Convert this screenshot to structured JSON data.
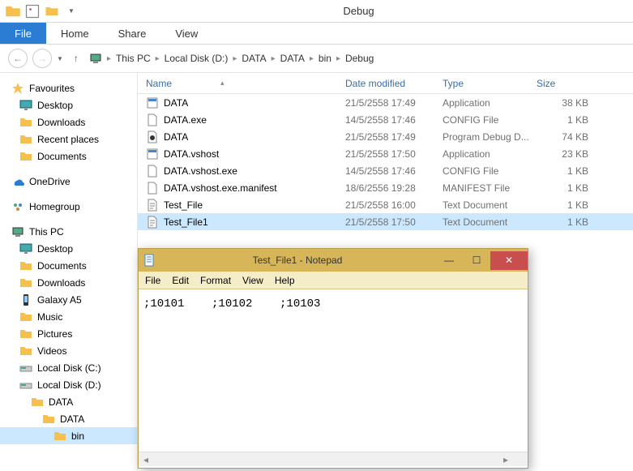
{
  "window": {
    "title": "Debug"
  },
  "ribbon": {
    "file": "File",
    "tabs": [
      "Home",
      "Share",
      "View"
    ]
  },
  "breadcrumb": [
    "This PC",
    "Local Disk (D:)",
    "DATA",
    "DATA",
    "bin",
    "Debug"
  ],
  "sidebar": {
    "favorites": {
      "label": "Favourites",
      "items": [
        "Desktop",
        "Downloads",
        "Recent places",
        "Documents"
      ]
    },
    "onedrive": "OneDrive",
    "homegroup": "Homegroup",
    "thispc": {
      "label": "This PC",
      "items": [
        "Desktop",
        "Documents",
        "Downloads",
        "Galaxy A5",
        "Music",
        "Pictures",
        "Videos",
        "Local Disk (C:)",
        "Local Disk (D:)"
      ],
      "d_tree": {
        "data": "DATA",
        "data2": "DATA",
        "bin": "bin"
      }
    }
  },
  "filelist": {
    "headers": {
      "name": "Name",
      "date": "Date modified",
      "type": "Type",
      "size": "Size"
    },
    "rows": [
      {
        "name": "DATA",
        "date": "21/5/2558 17:49",
        "type": "Application",
        "size": "38 KB",
        "icon": "exe"
      },
      {
        "name": "DATA.exe",
        "date": "14/5/2558 17:46",
        "type": "CONFIG File",
        "size": "1 KB",
        "icon": "file"
      },
      {
        "name": "DATA",
        "date": "21/5/2558 17:49",
        "type": "Program Debug D...",
        "size": "74 KB",
        "icon": "pdb"
      },
      {
        "name": "DATA.vshost",
        "date": "21/5/2558 17:50",
        "type": "Application",
        "size": "23 KB",
        "icon": "exe"
      },
      {
        "name": "DATA.vshost.exe",
        "date": "14/5/2558 17:46",
        "type": "CONFIG File",
        "size": "1 KB",
        "icon": "file"
      },
      {
        "name": "DATA.vshost.exe.manifest",
        "date": "18/6/2556 19:28",
        "type": "MANIFEST File",
        "size": "1 KB",
        "icon": "file"
      },
      {
        "name": "Test_File",
        "date": "21/5/2558 16:00",
        "type": "Text Document",
        "size": "1 KB",
        "icon": "txt"
      },
      {
        "name": "Test_File1",
        "date": "21/5/2558 17:50",
        "type": "Text Document",
        "size": "1 KB",
        "icon": "txt",
        "selected": true
      }
    ]
  },
  "notepad": {
    "title": "Test_File1 - Notepad",
    "menu": [
      "File",
      "Edit",
      "Format",
      "View",
      "Help"
    ],
    "content": ";10101    ;10102    ;10103"
  }
}
